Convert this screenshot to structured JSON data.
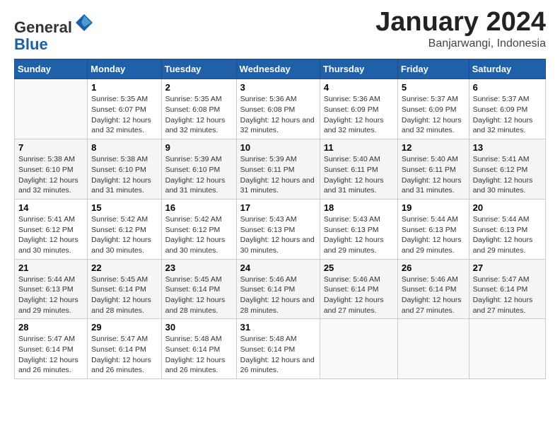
{
  "header": {
    "logo_general": "General",
    "logo_blue": "Blue",
    "month": "January 2024",
    "location": "Banjarwangi, Indonesia"
  },
  "days_of_week": [
    "Sunday",
    "Monday",
    "Tuesday",
    "Wednesday",
    "Thursday",
    "Friday",
    "Saturday"
  ],
  "weeks": [
    [
      {
        "day": "",
        "sunrise": "",
        "sunset": "",
        "daylight": ""
      },
      {
        "day": "1",
        "sunrise": "5:35 AM",
        "sunset": "6:07 PM",
        "daylight": "12 hours and 32 minutes."
      },
      {
        "day": "2",
        "sunrise": "5:35 AM",
        "sunset": "6:08 PM",
        "daylight": "12 hours and 32 minutes."
      },
      {
        "day": "3",
        "sunrise": "5:36 AM",
        "sunset": "6:08 PM",
        "daylight": "12 hours and 32 minutes."
      },
      {
        "day": "4",
        "sunrise": "5:36 AM",
        "sunset": "6:09 PM",
        "daylight": "12 hours and 32 minutes."
      },
      {
        "day": "5",
        "sunrise": "5:37 AM",
        "sunset": "6:09 PM",
        "daylight": "12 hours and 32 minutes."
      },
      {
        "day": "6",
        "sunrise": "5:37 AM",
        "sunset": "6:09 PM",
        "daylight": "12 hours and 32 minutes."
      }
    ],
    [
      {
        "day": "7",
        "sunrise": "5:38 AM",
        "sunset": "6:10 PM",
        "daylight": "12 hours and 32 minutes."
      },
      {
        "day": "8",
        "sunrise": "5:38 AM",
        "sunset": "6:10 PM",
        "daylight": "12 hours and 31 minutes."
      },
      {
        "day": "9",
        "sunrise": "5:39 AM",
        "sunset": "6:10 PM",
        "daylight": "12 hours and 31 minutes."
      },
      {
        "day": "10",
        "sunrise": "5:39 AM",
        "sunset": "6:11 PM",
        "daylight": "12 hours and 31 minutes."
      },
      {
        "day": "11",
        "sunrise": "5:40 AM",
        "sunset": "6:11 PM",
        "daylight": "12 hours and 31 minutes."
      },
      {
        "day": "12",
        "sunrise": "5:40 AM",
        "sunset": "6:11 PM",
        "daylight": "12 hours and 31 minutes."
      },
      {
        "day": "13",
        "sunrise": "5:41 AM",
        "sunset": "6:12 PM",
        "daylight": "12 hours and 30 minutes."
      }
    ],
    [
      {
        "day": "14",
        "sunrise": "5:41 AM",
        "sunset": "6:12 PM",
        "daylight": "12 hours and 30 minutes."
      },
      {
        "day": "15",
        "sunrise": "5:42 AM",
        "sunset": "6:12 PM",
        "daylight": "12 hours and 30 minutes."
      },
      {
        "day": "16",
        "sunrise": "5:42 AM",
        "sunset": "6:12 PM",
        "daylight": "12 hours and 30 minutes."
      },
      {
        "day": "17",
        "sunrise": "5:43 AM",
        "sunset": "6:13 PM",
        "daylight": "12 hours and 30 minutes."
      },
      {
        "day": "18",
        "sunrise": "5:43 AM",
        "sunset": "6:13 PM",
        "daylight": "12 hours and 29 minutes."
      },
      {
        "day": "19",
        "sunrise": "5:44 AM",
        "sunset": "6:13 PM",
        "daylight": "12 hours and 29 minutes."
      },
      {
        "day": "20",
        "sunrise": "5:44 AM",
        "sunset": "6:13 PM",
        "daylight": "12 hours and 29 minutes."
      }
    ],
    [
      {
        "day": "21",
        "sunrise": "5:44 AM",
        "sunset": "6:13 PM",
        "daylight": "12 hours and 29 minutes."
      },
      {
        "day": "22",
        "sunrise": "5:45 AM",
        "sunset": "6:14 PM",
        "daylight": "12 hours and 28 minutes."
      },
      {
        "day": "23",
        "sunrise": "5:45 AM",
        "sunset": "6:14 PM",
        "daylight": "12 hours and 28 minutes."
      },
      {
        "day": "24",
        "sunrise": "5:46 AM",
        "sunset": "6:14 PM",
        "daylight": "12 hours and 28 minutes."
      },
      {
        "day": "25",
        "sunrise": "5:46 AM",
        "sunset": "6:14 PM",
        "daylight": "12 hours and 27 minutes."
      },
      {
        "day": "26",
        "sunrise": "5:46 AM",
        "sunset": "6:14 PM",
        "daylight": "12 hours and 27 minutes."
      },
      {
        "day": "27",
        "sunrise": "5:47 AM",
        "sunset": "6:14 PM",
        "daylight": "12 hours and 27 minutes."
      }
    ],
    [
      {
        "day": "28",
        "sunrise": "5:47 AM",
        "sunset": "6:14 PM",
        "daylight": "12 hours and 26 minutes."
      },
      {
        "day": "29",
        "sunrise": "5:47 AM",
        "sunset": "6:14 PM",
        "daylight": "12 hours and 26 minutes."
      },
      {
        "day": "30",
        "sunrise": "5:48 AM",
        "sunset": "6:14 PM",
        "daylight": "12 hours and 26 minutes."
      },
      {
        "day": "31",
        "sunrise": "5:48 AM",
        "sunset": "6:14 PM",
        "daylight": "12 hours and 26 minutes."
      },
      {
        "day": "",
        "sunrise": "",
        "sunset": "",
        "daylight": ""
      },
      {
        "day": "",
        "sunrise": "",
        "sunset": "",
        "daylight": ""
      },
      {
        "day": "",
        "sunrise": "",
        "sunset": "",
        "daylight": ""
      }
    ]
  ]
}
